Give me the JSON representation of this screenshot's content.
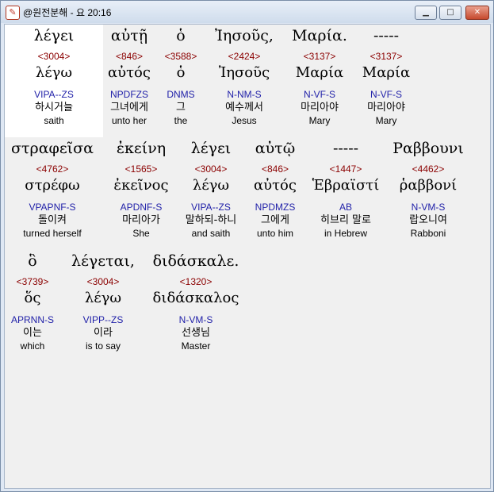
{
  "window": {
    "title": "@원전분해 - 요 20:16",
    "app_icon": "book-icon",
    "minimize_icon": "minimize-icon",
    "maximize_icon": "maximize-icon",
    "close_icon": "close-icon"
  },
  "colors": {
    "strong_number": "#8b0000",
    "morphology": "#1f1fa8",
    "highlight": "#ffffff",
    "background": "#f0f0f0"
  },
  "lines": [
    {
      "words": [
        {
          "greek": "λέγει",
          "strong": "<3004>",
          "lemma": "λέγω",
          "morph": "VIPA--ZS",
          "korean": "하시거늘",
          "english": "saith",
          "highlighted": true
        },
        {
          "greek": "αὐτῇ",
          "strong": "<846>",
          "lemma": "αὐτός",
          "morph": "NPDFZS",
          "korean": "그녀에게",
          "english": "unto her"
        },
        {
          "greek": "ὁ",
          "strong": "<3588>",
          "lemma": "ὁ",
          "morph": "DNMS",
          "korean": "그",
          "english": "the"
        },
        {
          "greek": "Ἰησοῦς,",
          "strong": "<2424>",
          "lemma": "Ἰησοῦς",
          "morph": "N-NM-S",
          "korean": "예수께서",
          "english": "Jesus"
        },
        {
          "greek": "Μαρία.",
          "strong": "<3137>",
          "lemma": "Μαρία",
          "morph": "N-VF-S",
          "korean": "마리아야",
          "english": "Mary"
        },
        {
          "greek": "-----",
          "strong": "<3137>",
          "lemma": "Μαρία",
          "morph": "N-VF-S",
          "korean": "마리아야",
          "english": "Mary"
        }
      ]
    },
    {
      "words": [
        {
          "greek": "στραφεῖσα",
          "strong": "<4762>",
          "lemma": "στρέφω",
          "morph": "VPAPNF-S",
          "korean": "돌이켜",
          "english": "turned herself"
        },
        {
          "greek": "ἐκείνη",
          "strong": "<1565>",
          "lemma": "ἐκεῖνος",
          "morph": "APDNF-S",
          "korean": "마리아가",
          "english": "She"
        },
        {
          "greek": "λέγει",
          "strong": "<3004>",
          "lemma": "λέγω",
          "morph": "VIPA--ZS",
          "korean": "말하되-하니",
          "english": "and saith"
        },
        {
          "greek": "αὐτῷ",
          "strong": "<846>",
          "lemma": "αὐτός",
          "morph": "NPDMZS",
          "korean": "그에게",
          "english": "unto him"
        },
        {
          "greek": "-----",
          "strong": "<1447>",
          "lemma": "Ἑβραϊστί",
          "morph": "AB",
          "korean": "히브리 말로",
          "english": "in Hebrew"
        },
        {
          "greek": "Ραββουνι",
          "strong": "<4462>",
          "lemma": "ῥαββονί",
          "morph": "N-VM-S",
          "korean": "랍오니여",
          "english": "Rabboni"
        }
      ]
    },
    {
      "words": [
        {
          "greek": "ὃ",
          "strong": "<3739>",
          "lemma": "ὅς",
          "morph": "APRNN-S",
          "korean": "이는",
          "english": "which"
        },
        {
          "greek": "λέγεται,",
          "strong": "<3004>",
          "lemma": "λέγω",
          "morph": "VIPP--ZS",
          "korean": "이라",
          "english": "is to say"
        },
        {
          "greek": "διδάσκαλε.",
          "strong": "<1320>",
          "lemma": "διδάσκαλος",
          "morph": "N-VM-S",
          "korean": "선생님",
          "english": "Master"
        }
      ]
    }
  ]
}
